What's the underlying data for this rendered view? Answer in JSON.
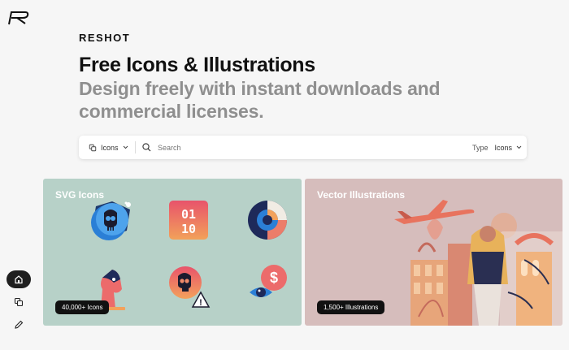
{
  "brand": {
    "wordmark": "RESHOT"
  },
  "hero": {
    "title": "Free Icons & Illustrations",
    "subtitle": "Design freely with instant downloads and commercial licenses."
  },
  "search": {
    "category": "Icons",
    "placeholder": "Search",
    "type_label": "Type",
    "type_value": "Icons"
  },
  "cards": [
    {
      "title": "SVG Icons",
      "badge": "40,000+ Icons"
    },
    {
      "title": "Vector Illustrations",
      "badge": "1,500+ Illustrations"
    }
  ],
  "icon_text": {
    "digits_top": "01",
    "digits_bottom": "10",
    "dollar": "$",
    "warning": "!"
  },
  "nav": [
    "home-icon",
    "copy-icon",
    "pencil-icon"
  ],
  "colors": {
    "svg_card": "#b7d1c8",
    "vector_card": "#d6bdbc",
    "nav_active": "#1f1f1f"
  }
}
